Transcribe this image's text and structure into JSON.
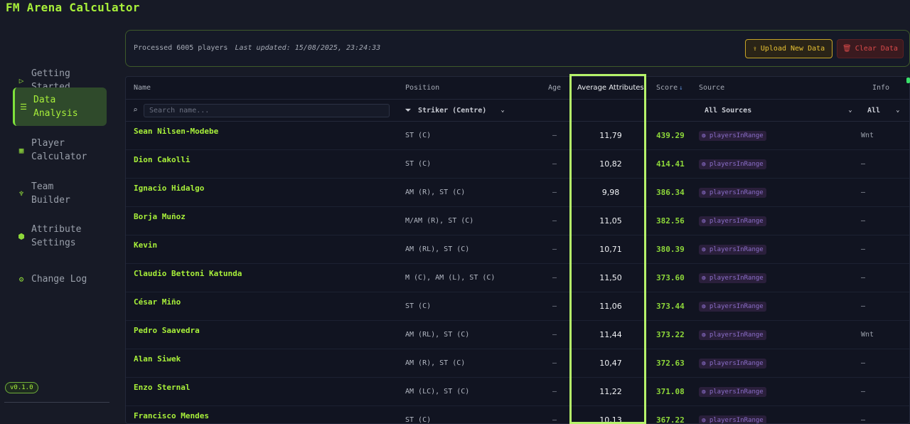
{
  "app": {
    "title": "FM Arena Calculator",
    "version": "v0.1.0"
  },
  "sidebar": {
    "items": [
      {
        "line1": "Getting",
        "line2": "Started",
        "icon": "play-icon",
        "active": false
      },
      {
        "line1": "Data",
        "line2": "Analysis",
        "icon": "database-icon",
        "active": true
      },
      {
        "line1": "Player",
        "line2": "Calculator",
        "icon": "calculator-icon",
        "active": false
      },
      {
        "line1": "Team",
        "line2": "Builder",
        "icon": "trophy-icon",
        "active": false
      },
      {
        "line1": "Attribute",
        "line2": "Settings",
        "icon": "hexagon-icon",
        "active": false
      },
      {
        "line1": "Change Log",
        "line2": "",
        "icon": "gear-icon",
        "active": false
      }
    ]
  },
  "status": {
    "processed": "Processed 6005 players",
    "updated": "Last updated: 15/08/2025, 23:24:33",
    "upload_label": "Upload New Data",
    "clear_label": "Clear Data"
  },
  "table": {
    "headers": {
      "name": "Name",
      "position": "Position",
      "age": "Age",
      "avg": "Average Attributes",
      "score": "Score",
      "score_sort": "↓",
      "source": "Source",
      "info": "Info"
    },
    "filters": {
      "search_placeholder": "Search name...",
      "position": "Striker (Centre)",
      "source": "All Sources",
      "info": "All"
    },
    "rows": [
      {
        "name": "Sean Nilsen-Modebe",
        "position": "ST (C)",
        "age": "–",
        "avg": "11,79",
        "score": "439.29",
        "source": "playersInRange",
        "info": "Wnt"
      },
      {
        "name": "Dion Cakolli",
        "position": "ST (C)",
        "age": "–",
        "avg": "10,82",
        "score": "414.41",
        "source": "playersInRange",
        "info": "–"
      },
      {
        "name": "Ignacio Hidalgo",
        "position": "AM (R), ST (C)",
        "age": "–",
        "avg": "9,98",
        "score": "386.34",
        "source": "playersInRange",
        "info": "–"
      },
      {
        "name": "Borja Muñoz",
        "position": "M/AM (R), ST (C)",
        "age": "–",
        "avg": "11,05",
        "score": "382.56",
        "source": "playersInRange",
        "info": "–"
      },
      {
        "name": "Kevin",
        "position": "AM (RL), ST (C)",
        "age": "–",
        "avg": "10,71",
        "score": "380.39",
        "source": "playersInRange",
        "info": "–"
      },
      {
        "name": "Claudio Bettoni Katunda",
        "position": "M (C), AM (L), ST (C)",
        "age": "–",
        "avg": "11,50",
        "score": "373.60",
        "source": "playersInRange",
        "info": "–"
      },
      {
        "name": "César Miño",
        "position": "ST (C)",
        "age": "–",
        "avg": "11,06",
        "score": "373.44",
        "source": "playersInRange",
        "info": "–"
      },
      {
        "name": "Pedro Saavedra",
        "position": "AM (RL), ST (C)",
        "age": "–",
        "avg": "11,44",
        "score": "373.22",
        "source": "playersInRange",
        "info": "Wnt"
      },
      {
        "name": "Alan Siwek",
        "position": "AM (R), ST (C)",
        "age": "–",
        "avg": "10,47",
        "score": "372.63",
        "source": "playersInRange",
        "info": "–"
      },
      {
        "name": "Enzo Sternal",
        "position": "AM (LC), ST (C)",
        "age": "–",
        "avg": "11,22",
        "score": "371.08",
        "source": "playersInRange",
        "info": "–"
      },
      {
        "name": "Francisco Mendes",
        "position": "ST (C)",
        "age": "–",
        "avg": "10,13",
        "score": "367.22",
        "source": "playersInRange",
        "info": "–"
      }
    ]
  },
  "colors": {
    "accent": "#a8f03a",
    "highlight": "#b6f36a",
    "warning": "#e8c233",
    "danger": "#d94a4a"
  }
}
